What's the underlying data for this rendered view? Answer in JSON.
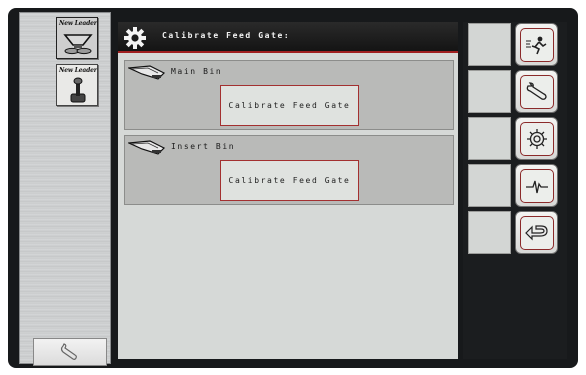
{
  "header": {
    "title": "Calibrate Feed Gate:"
  },
  "left_panel": {
    "brand_label_1": "New Leader",
    "brand_label_2": "New Leader"
  },
  "bins": [
    {
      "label": "Main Bin",
      "button_label": "Calibrate Feed Gate"
    },
    {
      "label": "Insert Bin",
      "button_label": "Calibrate Feed Gate"
    }
  ],
  "softkeys": [
    {
      "icon": "operator-run-icon"
    },
    {
      "icon": "wrench-icon"
    },
    {
      "icon": "gear-icon"
    },
    {
      "icon": "diagnostic-pulse-icon"
    },
    {
      "icon": "back-arrow-icon"
    }
  ],
  "colors": {
    "accent_red": "#a02020",
    "panel_gray": "#b9bab8",
    "background_dark": "#17191b"
  }
}
